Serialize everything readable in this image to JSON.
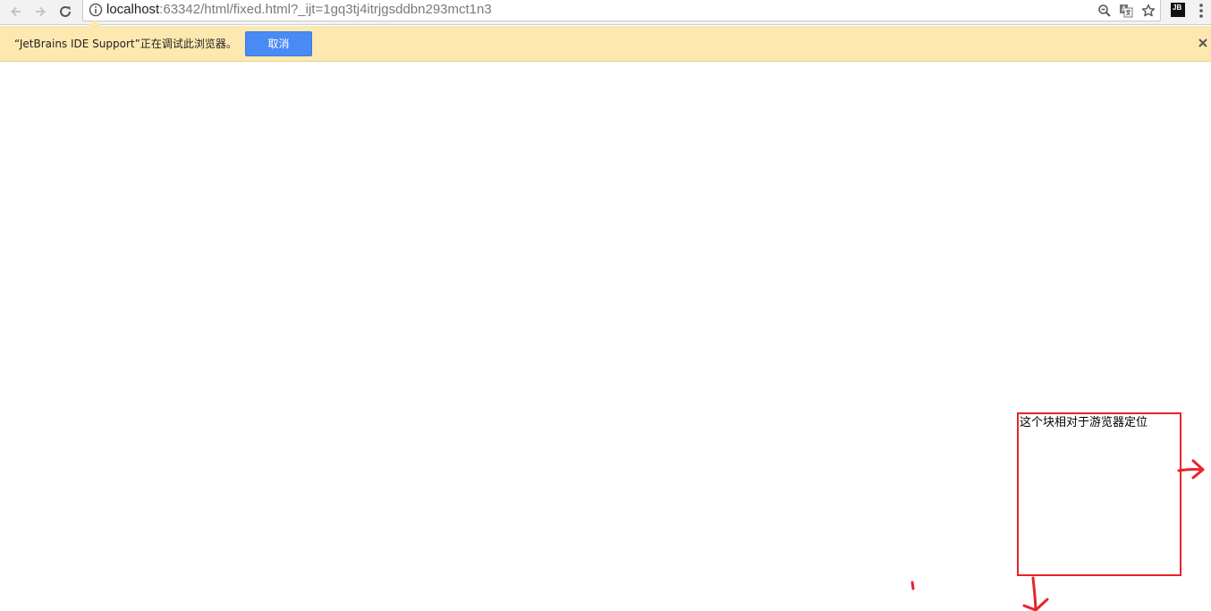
{
  "toolbar": {
    "url_host": "localhost",
    "url_rest": ":63342/html/fixed.html?_ijt=1gq3tj4itrjgsddbn293mct1n3",
    "extension_label": "JB",
    "icons": [
      "back-arrow-icon",
      "forward-arrow-icon",
      "reload-icon",
      "info-icon",
      "zoom-icon",
      "translate-icon",
      "star-icon",
      "menu-dots-icon"
    ]
  },
  "infobar": {
    "message": "“JetBrains IDE Support”正在调试此浏览器。",
    "cancel_label": "取消",
    "background_color": "#fde9b0",
    "button_color": "#4a8af4"
  },
  "page": {
    "fixed_box_text": "这个块相对于游览器定位",
    "box_border_color": "#e8232b",
    "annotation_color": "#e8232b"
  }
}
